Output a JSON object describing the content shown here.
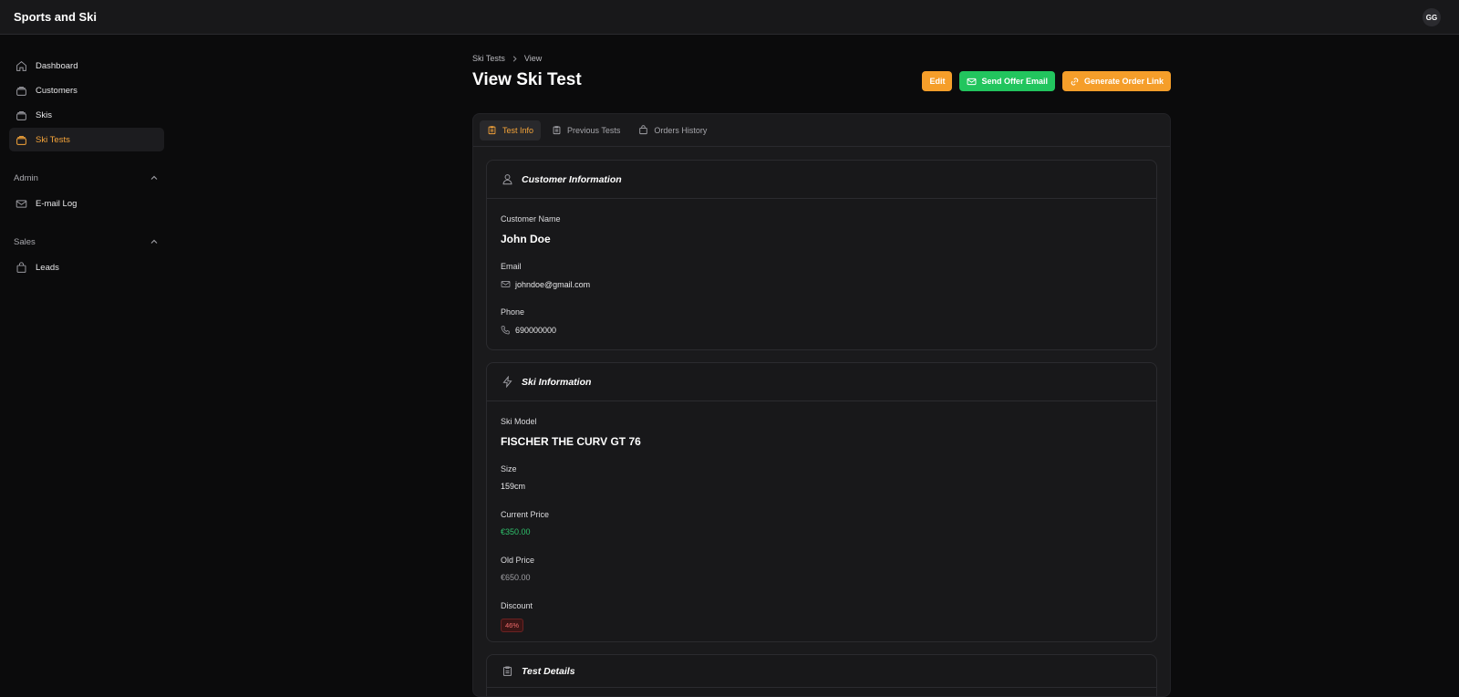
{
  "app": {
    "title": "Sports and Ski",
    "avatar_initials": "GG"
  },
  "sidebar": {
    "items": [
      {
        "label": "Dashboard",
        "icon": "home-icon"
      },
      {
        "label": "Customers",
        "icon": "box-icon"
      },
      {
        "label": "Skis",
        "icon": "box-icon"
      },
      {
        "label": "Ski Tests",
        "icon": "box-icon",
        "active": true
      }
    ],
    "groups": [
      {
        "label": "Admin",
        "items": [
          {
            "label": "E-mail Log",
            "icon": "mail-icon"
          }
        ]
      },
      {
        "label": "Sales",
        "items": [
          {
            "label": "Leads",
            "icon": "bag-icon"
          }
        ]
      }
    ]
  },
  "breadcrumb": {
    "parent": "Ski Tests",
    "current": "View"
  },
  "page": {
    "title": "View Ski Test"
  },
  "actions": {
    "edit": "Edit",
    "send_offer": "Send Offer Email",
    "generate_link": "Generate Order Link"
  },
  "tabs": [
    {
      "label": "Test Info",
      "active": true
    },
    {
      "label": "Previous Tests"
    },
    {
      "label": "Orders History"
    }
  ],
  "customer": {
    "section_title": "Customer Information",
    "name_label": "Customer Name",
    "name": "John Doe",
    "email_label": "Email",
    "email": "johndoe@gmail.com",
    "phone_label": "Phone",
    "phone": "690000000"
  },
  "ski": {
    "section_title": "Ski Information",
    "model_label": "Ski Model",
    "model": "FISCHER THE CURV GT 76",
    "size_label": "Size",
    "size": "159cm",
    "current_price_label": "Current Price",
    "current_price": "€350.00",
    "old_price_label": "Old Price",
    "old_price": "€650.00",
    "discount_label": "Discount",
    "discount": "46%"
  },
  "test_details": {
    "section_title": "Test Details"
  },
  "colors": {
    "accent": "#f59e2a",
    "success": "#22c55e",
    "danger": "#ef6b6b"
  }
}
